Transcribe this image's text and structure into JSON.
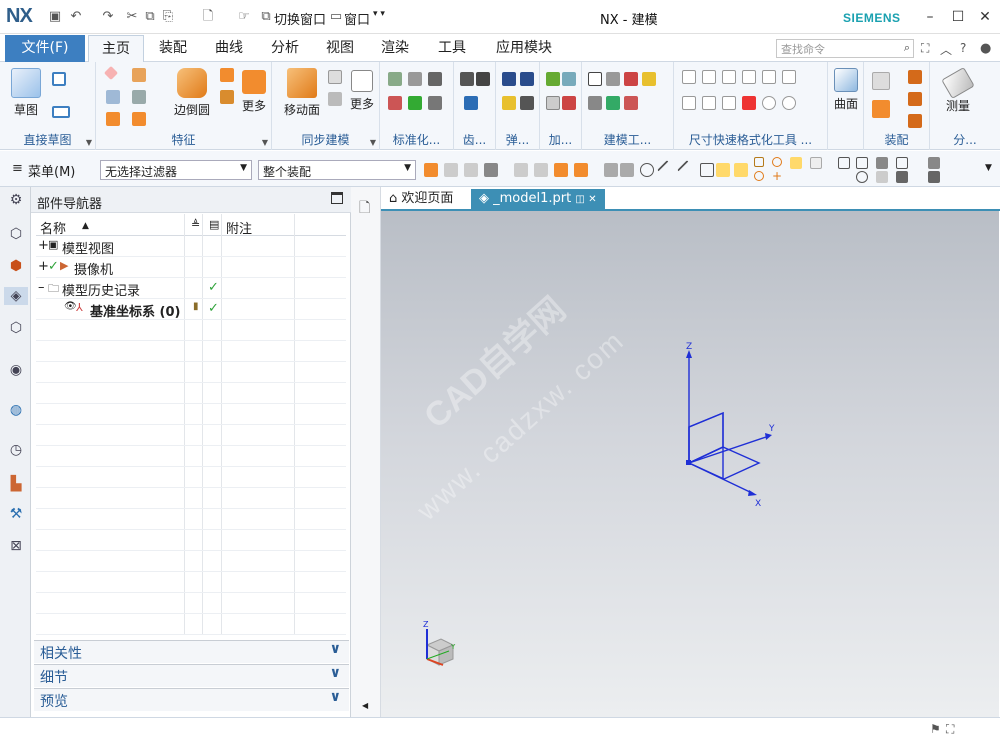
{
  "app": {
    "logo": "NX",
    "window_title": "NX - 建模",
    "brand": "SIEMENS",
    "quick_access": {
      "switch_window": "切换窗口",
      "window": "窗口"
    }
  },
  "menubar": {
    "file": "文件(F)",
    "tabs": [
      "主页",
      "装配",
      "曲线",
      "分析",
      "视图",
      "渲染",
      "工具",
      "应用模块"
    ],
    "search_placeholder": "查找命令"
  },
  "ribbon": {
    "groups": {
      "sketch": {
        "label": "直接草图",
        "sketch_btn": "草图"
      },
      "feature": {
        "label": "特征",
        "edge_blend": "边倒圆",
        "more": "更多"
      },
      "sync": {
        "label": "同步建模",
        "move_face": "移动面",
        "more": "更多"
      },
      "standard": {
        "label": "标准化..."
      },
      "gear": {
        "label": "齿..."
      },
      "spring": {
        "label": "弹..."
      },
      "add": {
        "label": "加..."
      },
      "build": {
        "label": "建模工..."
      },
      "dimfmt": {
        "label": "尺寸快速格式化工具 ..."
      },
      "surface": {
        "label": "曲面"
      },
      "assembly": {
        "label": "装配"
      },
      "analysis": {
        "label": "分...",
        "measure": "测量"
      }
    }
  },
  "toolbar2": {
    "menu": "菜单(M)",
    "filter": "无选择过滤器",
    "scope": "整个装配"
  },
  "navigator": {
    "title": "部件导航器",
    "columns": {
      "name": "名称",
      "notes": "附注"
    },
    "rows": [
      {
        "label": "模型视图"
      },
      {
        "label": "摄像机"
      },
      {
        "label": "模型历史记录"
      },
      {
        "label": "基准坐标系 (0)"
      }
    ],
    "panels": [
      "相关性",
      "细节",
      "预览"
    ]
  },
  "canvas": {
    "tabs": [
      "欢迎页面",
      "_model1.prt"
    ],
    "watermark_cn": "CAD自学网",
    "watermark_url": "www. cadzxw. com",
    "axes": {
      "x": "X",
      "y": "Y",
      "z": "Z"
    }
  },
  "colors": {
    "accent": "#3d7fc1",
    "brand": "#1aa1b0",
    "datum": "#1f2fd6",
    "check": "#2fa33a"
  }
}
